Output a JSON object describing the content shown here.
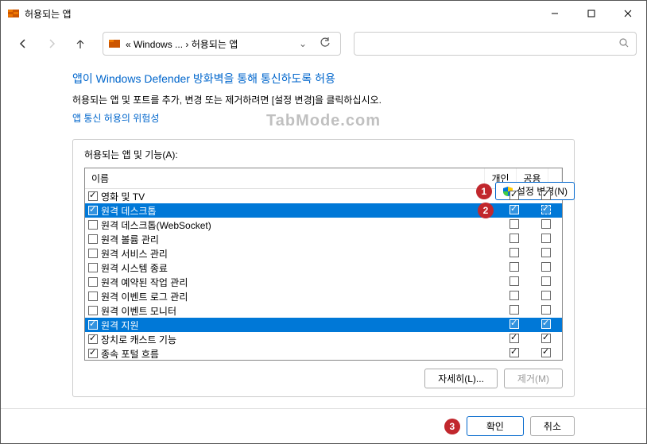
{
  "window": {
    "title": "허용되는 앱"
  },
  "breadcrumb": {
    "prefix": "«",
    "part1": "Windows ...",
    "sep": "›",
    "part2": "허용되는 앱"
  },
  "heading": "앱이 Windows Defender 방화벽을 통해 통신하도록 허용",
  "subtext": "허용되는 앱 및 포트를 추가, 변경 또는 제거하려면 [설정 변경]을 클릭하십시오.",
  "risk_link": "앱 통신 허용의 위험성",
  "settings_button": "설정 변경(N)",
  "panel_title": "허용되는 앱 및 기능(A):",
  "columns": {
    "name": "이름",
    "private": "개인",
    "public": "공용"
  },
  "rows": [
    {
      "name": "영화 및 TV",
      "enabled": true,
      "private": true,
      "public": true,
      "selected": false
    },
    {
      "name": "원격 데스크톱",
      "enabled": true,
      "private": true,
      "public": true,
      "selected": true,
      "badge": "2",
      "pub_dashed": true
    },
    {
      "name": "원격 데스크톱(WebSocket)",
      "enabled": false,
      "private": false,
      "public": false,
      "selected": false
    },
    {
      "name": "원격 볼륨 관리",
      "enabled": false,
      "private": false,
      "public": false,
      "selected": false
    },
    {
      "name": "원격 서비스 관리",
      "enabled": false,
      "private": false,
      "public": false,
      "selected": false
    },
    {
      "name": "원격 시스템 종료",
      "enabled": false,
      "private": false,
      "public": false,
      "selected": false
    },
    {
      "name": "원격 예약된 작업 관리",
      "enabled": false,
      "private": false,
      "public": false,
      "selected": false
    },
    {
      "name": "원격 이벤트 로그 관리",
      "enabled": false,
      "private": false,
      "public": false,
      "selected": false
    },
    {
      "name": "원격 이벤트 모니터",
      "enabled": false,
      "private": false,
      "public": false,
      "selected": false
    },
    {
      "name": "원격 지원",
      "enabled": true,
      "private": true,
      "public": true,
      "selected": false,
      "highlighted": true
    },
    {
      "name": "장치로 캐스트 기능",
      "enabled": true,
      "private": true,
      "public": true,
      "selected": false
    },
    {
      "name": "종속 포털 흐름",
      "enabled": true,
      "private": true,
      "public": true,
      "selected": false
    }
  ],
  "details_button": "자세히(L)...",
  "remove_button": "제거(M)",
  "ok_button": "확인",
  "cancel_button": "취소",
  "badges": {
    "one": "1",
    "three": "3"
  },
  "watermark": "TabMode.com"
}
